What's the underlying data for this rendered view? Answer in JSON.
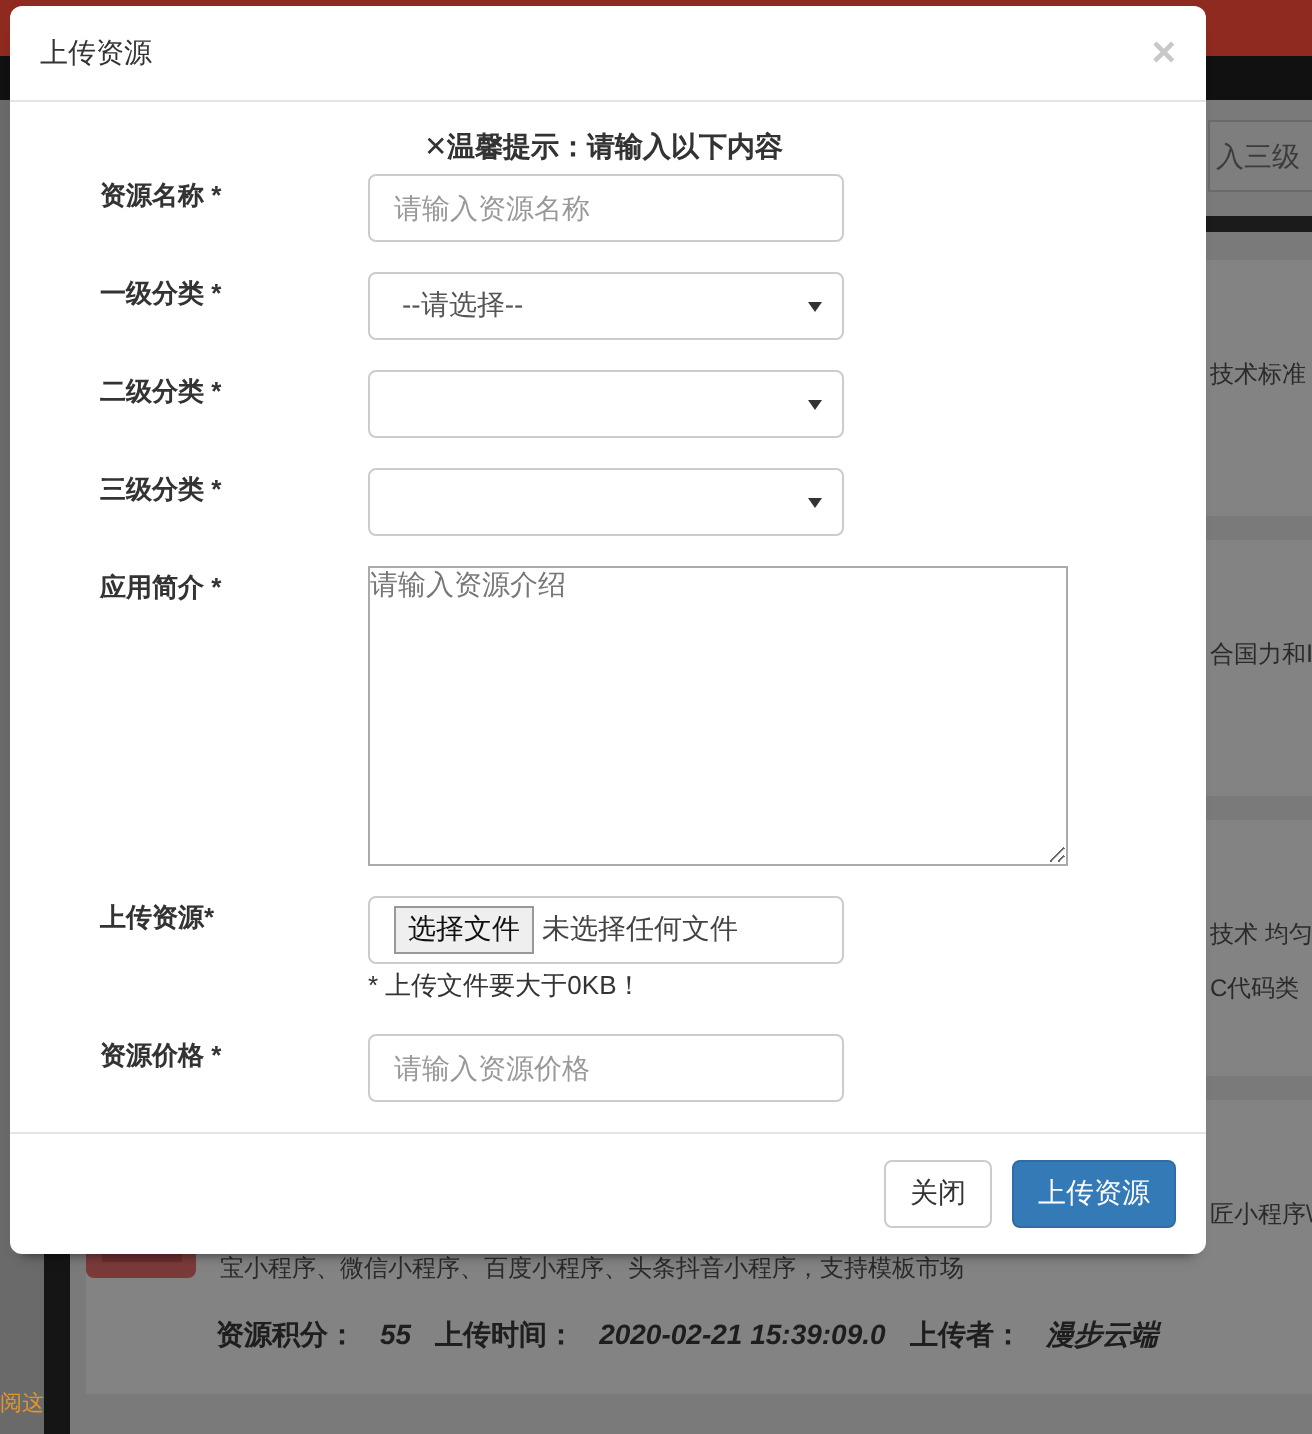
{
  "background": {
    "search_placeholder": "入三级",
    "cards": [
      {
        "lines": [
          "技术标准"
        ],
        "thumbnail": false
      },
      {
        "lines": [
          "合国力和Ⅰ"
        ],
        "thumbnail": false
      },
      {
        "lines": [
          "技术 均匀",
          "C代码类"
        ],
        "thumbnail": false
      },
      {
        "lines": [
          "匠小程序\\",
          "宝小程序、微信小程序、百度小程序、头条抖音小程序，支持模板市场"
        ],
        "thumbnail": true,
        "meta": [
          {
            "label": "资源积分：",
            "value": "55"
          },
          {
            "label": "上传时间：",
            "value": "2020-02-21 15:39:09.0"
          },
          {
            "label": "上传者：",
            "value": "漫步云端"
          }
        ]
      }
    ],
    "side_link": "阅这"
  },
  "modal": {
    "title": "上传资源",
    "close": "×",
    "hint": "✕温馨提示：请输入以下内容",
    "fields": [
      {
        "kind": "text",
        "label": "资源名称 *",
        "placeholder": "请输入资源名称"
      },
      {
        "kind": "select",
        "label": "一级分类 *",
        "value": "--请选择--"
      },
      {
        "kind": "select",
        "label": "二级分类 *"
      },
      {
        "kind": "select",
        "label": "三级分类 *"
      },
      {
        "kind": "textarea",
        "label": "应用简介 *",
        "placeholder": "请输入资源介绍"
      },
      {
        "kind": "file",
        "label": "上传资源*",
        "button": "选择文件",
        "status": "未选择任何文件",
        "note": "* 上传文件要大于0KB！"
      },
      {
        "kind": "text",
        "label": "资源价格 *",
        "placeholder": "请输入资源价格"
      }
    ],
    "buttons": [
      {
        "label": "关闭",
        "kind": "default"
      },
      {
        "label": "上传资源",
        "kind": "primary"
      }
    ]
  }
}
